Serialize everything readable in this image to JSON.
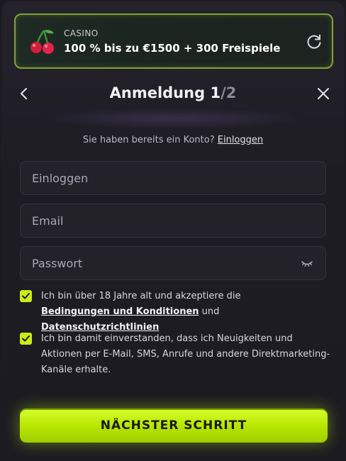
{
  "promo": {
    "tag": "CASINO",
    "offer": "100 % bis zu €1500 + 300 Freispiele"
  },
  "header": {
    "title": "Anmeldung",
    "step": "1",
    "total": "/2"
  },
  "login_hint": {
    "text": "Sie haben bereits ein Konto?",
    "link": "Einloggen"
  },
  "form": {
    "username_placeholder": "Einloggen",
    "email_placeholder": "Email",
    "password_placeholder": "Passwort"
  },
  "consents": [
    {
      "checked": true,
      "text_before": "Ich bin über 18 Jahre alt und akzeptiere die",
      "link1": "Bedingungen und Konditionen",
      "joiner": "und",
      "link2": "Datenschutzrichtlinien"
    },
    {
      "checked": true,
      "text": "Ich bin damit einverstanden, dass ich Neuigkeiten und Aktionen per E-Mail, SMS, Anrufe und andere Direktmarketing-Kanäle erhalte."
    }
  ],
  "cta": {
    "label": "NÄCHSTER SCHRITT"
  },
  "colors": {
    "accent": "#c9ec1a",
    "promo_border": "#7fa33a",
    "background": "#1c1b21"
  },
  "icons": {
    "promo": "cherries-icon",
    "refresh": "refresh-icon",
    "back": "chevron-left-icon",
    "close": "close-icon",
    "password": "eye-closed-icon",
    "check": "check-icon"
  }
}
